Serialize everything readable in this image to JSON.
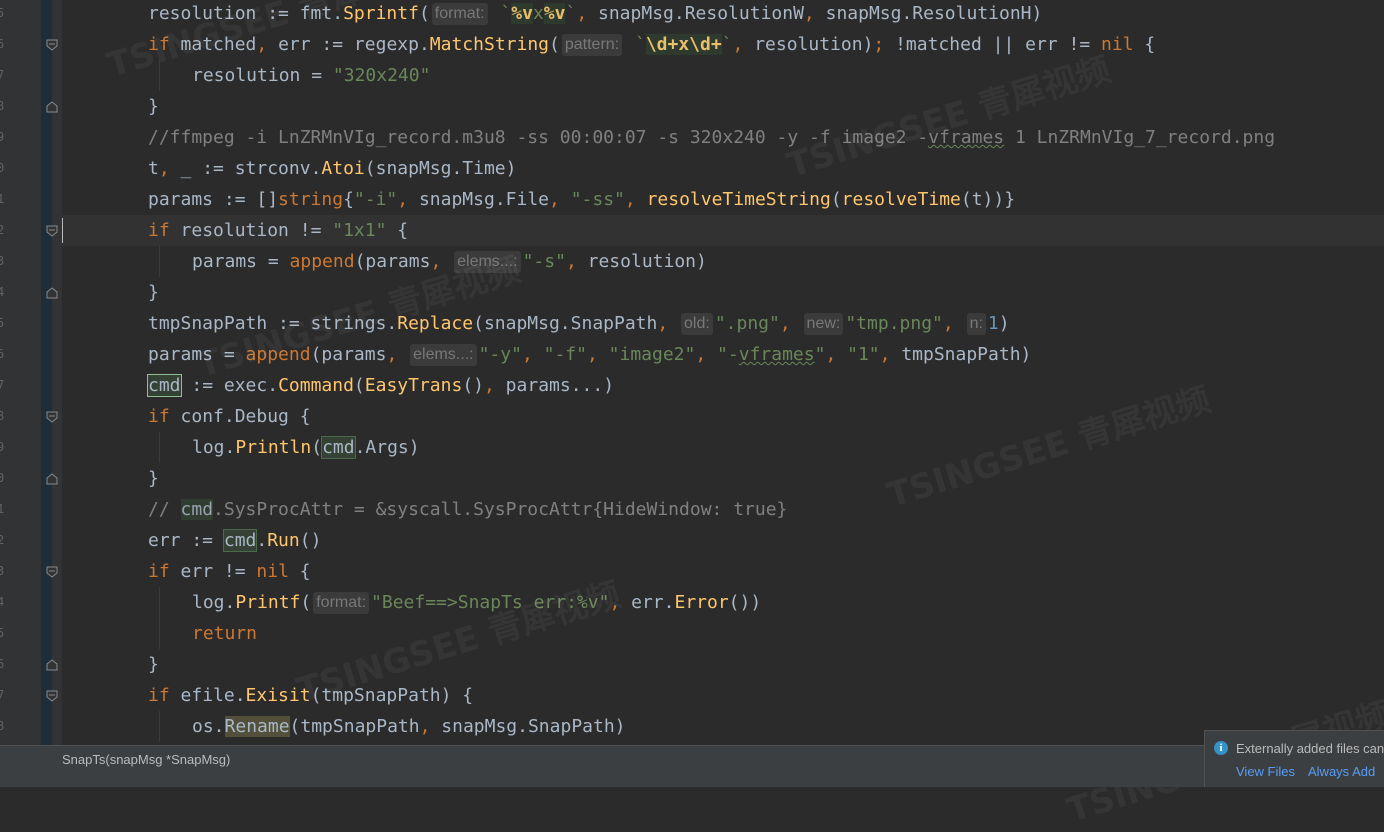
{
  "editor": {
    "theme_colors": {
      "background": "#2b2b2b",
      "keyword": "#cc7832",
      "string": "#6a8759",
      "function": "#ffc66d",
      "number": "#6897bb",
      "comment": "#808080"
    },
    "lines": [
      {
        "segs": [
          [
            "",
            "resolution := fmt."
          ],
          [
            "fn",
            "Sprintf"
          ],
          [
            "",
            "("
          ],
          [
            "hint",
            "format:"
          ],
          [
            "s",
            " `"
          ],
          [
            "re",
            "%v"
          ],
          [
            "s",
            "x"
          ],
          [
            "re",
            "%v"
          ],
          [
            "s",
            "`"
          ],
          [
            "k",
            ","
          ],
          [
            "",
            " snapMsg.ResolutionW"
          ],
          [
            "k",
            ","
          ],
          [
            "",
            " snapMsg.ResolutionH)"
          ]
        ]
      },
      {
        "segs": [
          [
            "k",
            "if"
          ],
          [
            "",
            " matched"
          ],
          [
            "k",
            ","
          ],
          [
            "",
            " err := regexp."
          ],
          [
            "fn",
            "MatchString"
          ],
          [
            "",
            "("
          ],
          [
            "hint",
            "pattern:"
          ],
          [
            "s",
            " `"
          ],
          [
            "re",
            "\\d+x\\d+"
          ],
          [
            "s",
            "`"
          ],
          [
            "k",
            ","
          ],
          [
            "",
            " resolution)"
          ],
          [
            "k",
            ";"
          ],
          [
            "",
            " !matched || err != "
          ],
          [
            "k",
            "nil"
          ],
          [
            "",
            " {"
          ]
        ]
      },
      {
        "segs": [
          [
            "",
            "resolution = "
          ],
          [
            "s",
            "\"320x240\""
          ]
        ]
      },
      {
        "segs": [
          [
            "",
            "}"
          ]
        ]
      },
      {
        "segs": [
          [
            "c",
            "//ffmpeg -i LnZRMnVIg_record.m3u8 -ss 00:00:07 -s 320x240 -y -f image2 -vframes 1 LnZRMnVIg_7_record.png"
          ]
        ]
      },
      {
        "segs": [
          [
            "",
            "t"
          ],
          [
            "k",
            ","
          ],
          [
            "",
            " _ := strconv."
          ],
          [
            "fn",
            "Atoi"
          ],
          [
            "",
            "(snapMsg.Time)"
          ]
        ]
      },
      {
        "segs": [
          [
            "",
            "params := []"
          ],
          [
            "k",
            "string"
          ],
          [
            "",
            "{"
          ],
          [
            "s",
            "\"-i\""
          ],
          [
            "k",
            ","
          ],
          [
            "",
            " snapMsg.File"
          ],
          [
            "k",
            ","
          ],
          [
            "s",
            " \"-ss\""
          ],
          [
            "k",
            ","
          ],
          [
            "",
            " "
          ],
          [
            "fn",
            "resolveTimeString"
          ],
          [
            "",
            "("
          ],
          [
            "fn",
            "resolveTime"
          ],
          [
            "",
            "(t))}"
          ]
        ]
      },
      {
        "segs": [
          [
            "k",
            "if"
          ],
          [
            "",
            " resolution != "
          ],
          [
            "s",
            "\"1x1\""
          ],
          [
            "",
            " {"
          ]
        ]
      },
      {
        "segs": [
          [
            "",
            "params = "
          ],
          [
            "k",
            "append"
          ],
          [
            "",
            "(params"
          ],
          [
            "k",
            ","
          ],
          [
            "",
            " "
          ],
          [
            "hint",
            "elems...:"
          ],
          [
            "s",
            "\"-s\""
          ],
          [
            "k",
            ","
          ],
          [
            "",
            " resolution)"
          ]
        ]
      },
      {
        "segs": [
          [
            "",
            "}"
          ]
        ]
      },
      {
        "segs": [
          [
            "",
            "tmpSnapPath := strings."
          ],
          [
            "fn",
            "Replace"
          ],
          [
            "",
            "(snapMsg.SnapPath"
          ],
          [
            "k",
            ","
          ],
          [
            "",
            " "
          ],
          [
            "hint",
            "old:"
          ],
          [
            "s",
            "\".png\""
          ],
          [
            "k",
            ","
          ],
          [
            "",
            " "
          ],
          [
            "hint",
            "new:"
          ],
          [
            "s",
            "\"tmp.png\""
          ],
          [
            "k",
            ","
          ],
          [
            "",
            " "
          ],
          [
            "hint",
            "n:"
          ],
          [
            "n",
            "1"
          ],
          [
            "",
            ")"
          ]
        ]
      },
      {
        "segs": [
          [
            "",
            "params = "
          ],
          [
            "k",
            "append"
          ],
          [
            "",
            "(params"
          ],
          [
            "k",
            ","
          ],
          [
            "",
            " "
          ],
          [
            "hint",
            "elems...:"
          ],
          [
            "s",
            "\"-y\""
          ],
          [
            "k",
            ","
          ],
          [
            "s",
            " \"-f\""
          ],
          [
            "k",
            ","
          ],
          [
            "s",
            " \"image2\""
          ],
          [
            "k",
            ","
          ],
          [
            "s",
            " \"-vframes\""
          ],
          [
            "k",
            ","
          ],
          [
            "s",
            " \"1\""
          ],
          [
            "k",
            ","
          ],
          [
            "",
            " tmpSnapPath)"
          ]
        ]
      },
      {
        "segs": [
          [
            "hlbox",
            "cmd"
          ],
          [
            "",
            " := exec."
          ],
          [
            "fn",
            "Command"
          ],
          [
            "",
            "("
          ],
          [
            "fn",
            "EasyTrans"
          ],
          [
            "",
            "()"
          ],
          [
            "k",
            ","
          ],
          [
            "",
            " params...)"
          ]
        ]
      },
      {
        "segs": [
          [
            "k",
            "if"
          ],
          [
            "",
            " conf.Debug {"
          ]
        ]
      },
      {
        "segs": [
          [
            "",
            "log."
          ],
          [
            "fn",
            "Println"
          ],
          [
            "",
            "("
          ],
          [
            "hl",
            "cmd"
          ],
          [
            "",
            ".Args)"
          ]
        ]
      },
      {
        "segs": [
          [
            "",
            "}"
          ]
        ]
      },
      {
        "segs": [
          [
            "c",
            "// "
          ],
          [
            "hldim",
            "cmd"
          ],
          [
            "c",
            ".SysProcAttr = &syscall.SysProcAttr{HideWindow: true}"
          ]
        ]
      },
      {
        "segs": [
          [
            "",
            "err := "
          ],
          [
            "hl",
            "cmd"
          ],
          [
            "",
            "."
          ],
          [
            "fn",
            "Run"
          ],
          [
            "",
            "()"
          ]
        ]
      },
      {
        "segs": [
          [
            "k",
            "if"
          ],
          [
            "",
            " err != "
          ],
          [
            "k",
            "nil"
          ],
          [
            "",
            " {"
          ]
        ]
      },
      {
        "segs": [
          [
            "",
            "log."
          ],
          [
            "fn",
            "Printf"
          ],
          [
            "",
            "("
          ],
          [
            "hint",
            "format:"
          ],
          [
            "s",
            "\"Beef==>SnapTs err:%v\""
          ],
          [
            "k",
            ","
          ],
          [
            "",
            " err."
          ],
          [
            "fn",
            "Error"
          ],
          [
            "",
            "())"
          ]
        ]
      },
      {
        "segs": [
          [
            "k",
            "return"
          ]
        ]
      },
      {
        "segs": [
          [
            "",
            "}"
          ]
        ]
      },
      {
        "segs": [
          [
            "k",
            "if"
          ],
          [
            "",
            " efile."
          ],
          [
            "fn",
            "Exisit"
          ],
          [
            "",
            "(tmpSnapPath) {"
          ]
        ]
      },
      {
        "segs": [
          [
            "",
            "os."
          ],
          [
            "hlwarn",
            "Rename"
          ],
          [
            "",
            "(tmpSnapPath"
          ],
          [
            "k",
            ","
          ],
          [
            "",
            " snapMsg.SnapPath)"
          ]
        ]
      }
    ],
    "gutter_numbers": [
      "5",
      "6",
      "7",
      "8",
      "9",
      "0",
      "1",
      "2",
      "3",
      "4",
      "5",
      "6",
      "7",
      "8",
      "9",
      "0",
      "1",
      "2",
      "3",
      "4",
      "5",
      "6",
      "7",
      "8"
    ]
  },
  "breadcrumb": {
    "label": "SnapTs(snapMsg *SnapMsg)"
  },
  "notification": {
    "text": "Externally added files can",
    "view_files": "View Files",
    "always_add": "Always Add"
  },
  "watermark": {
    "text": "TSINGSEE 青犀视频"
  }
}
